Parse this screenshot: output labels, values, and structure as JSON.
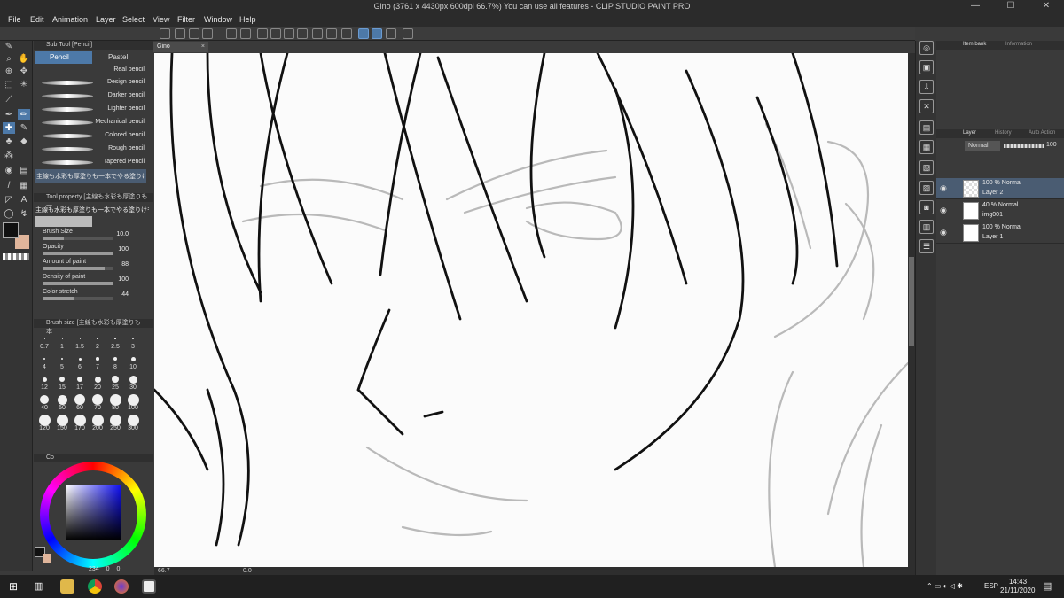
{
  "window": {
    "title": "Gino (3761 x 4430px 600dpi 66.7%)  You can use all features - CLIP STUDIO PAINT PRO"
  },
  "menu": [
    "File",
    "Edit",
    "Animation",
    "Layer",
    "Select",
    "View",
    "Filter",
    "Window",
    "Help"
  ],
  "subtool": {
    "header": "Sub Tool [Pencil]",
    "tabs": [
      "Pencil",
      "Pastel"
    ],
    "brushes": [
      "Real pencil",
      "Design pencil",
      "Darker pencil",
      "Lighter pencil",
      "Mechanical pencil",
      "Colored pencil",
      "Rough pencil",
      "Tapered Pencil"
    ],
    "custom_brush": "主線も水彩も厚塗りも一本でやる塗りけ"
  },
  "tool_property": {
    "header": "Tool property [主線も水彩も厚塗りも一",
    "brush_name": "主線も水彩も厚塗りも一本でやる塗りけものブラシ",
    "props": [
      {
        "label": "Brush Size",
        "value": "10.0",
        "fill": 0.3
      },
      {
        "label": "Opacity",
        "value": "100",
        "fill": 1.0
      },
      {
        "label": "Amount of paint",
        "value": "88",
        "fill": 0.88
      },
      {
        "label": "Density of paint",
        "value": "100",
        "fill": 1.0
      },
      {
        "label": "Color stretch",
        "value": "44",
        "fill": 0.44
      }
    ]
  },
  "brush_size": {
    "header": "Brush size [主線も水彩も厚塗りも一本",
    "sizes": [
      "0.7",
      "1",
      "1.5",
      "2",
      "2.5",
      "3",
      "4",
      "5",
      "6",
      "7",
      "8",
      "10",
      "12",
      "15",
      "17",
      "20",
      "25",
      "30",
      "40",
      "50",
      "60",
      "70",
      "80",
      "100",
      "120",
      "150",
      "170",
      "200",
      "250",
      "300"
    ]
  },
  "color": {
    "tab": "Co",
    "value_readout": "234",
    "value_readout2": "0",
    "value_readout3": "0"
  },
  "canvas": {
    "doc_tab": "Gino",
    "zoom": "66.7",
    "angle": "0.0"
  },
  "right_panel": {
    "tabs": [
      "Item bank",
      "Information"
    ],
    "layer_tabs": [
      "Layer",
      "History",
      "Auto Action"
    ],
    "blend_mode": "Normal",
    "opacity": "100",
    "layers": [
      {
        "mode": "100 % Normal",
        "name": "Layer 2",
        "selected": true
      },
      {
        "mode": "40 % Normal",
        "name": "img001",
        "selected": false
      },
      {
        "mode": "100 % Normal",
        "name": "Layer 1",
        "selected": false
      }
    ]
  },
  "taskbar": {
    "lang": "ESP",
    "time": "14:43",
    "date": "21/11/2020"
  }
}
